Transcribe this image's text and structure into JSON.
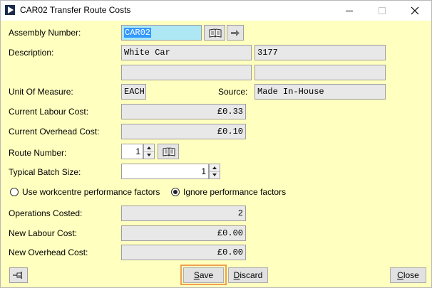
{
  "window": {
    "title": "CAR02 Transfer Route Costs"
  },
  "labels": {
    "assembly_number": "Assembly Number:",
    "description": "Description:",
    "unit_of_measure": "Unit Of Measure:",
    "source": "Source:",
    "current_labour_cost": "Current Labour Cost:",
    "current_overhead_cost": "Current Overhead Cost:",
    "route_number": "Route Number:",
    "typical_batch_size": "Typical Batch Size:",
    "use_workcentre": "Use workcentre performance factors",
    "ignore_performance": "Ignore performance factors",
    "operations_costed": "Operations Costed:",
    "new_labour_cost": "New Labour Cost:",
    "new_overhead_cost": "New Overhead Cost:"
  },
  "values": {
    "assembly_number": "CAR02",
    "description_1": "White Car",
    "description_2": "3177",
    "description_3": "",
    "description_4": "",
    "unit_of_measure": "EACH",
    "source": "Made In-House",
    "current_labour_cost": "£0.33",
    "current_overhead_cost": "£0.10",
    "route_number": "1",
    "typical_batch_size": "1",
    "operations_costed": "2",
    "new_labour_cost": "£0.00",
    "new_overhead_cost": "£0.00"
  },
  "performance_option": "ignore",
  "buttons": {
    "save": {
      "prefix": "",
      "mnemonic": "S",
      "rest": "ave"
    },
    "discard": {
      "prefix": "",
      "mnemonic": "D",
      "rest": "iscard"
    },
    "close": {
      "prefix": "",
      "mnemonic": "C",
      "rest": "lose"
    }
  },
  "icons": {
    "app": "app-play-icon",
    "lookup": "book-icon",
    "go": "arrow-right-icon",
    "pin": "pin-icon"
  }
}
